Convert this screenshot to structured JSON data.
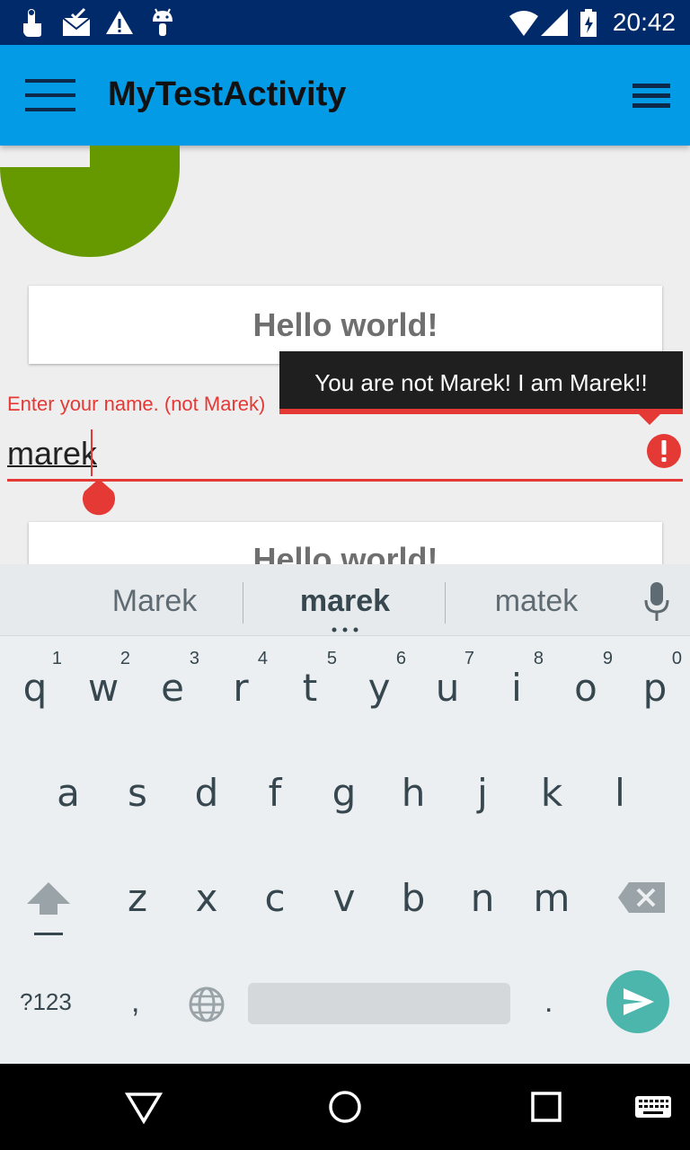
{
  "status_bar": {
    "time": "20:42",
    "icons": [
      "touch-icon",
      "mail-check-icon",
      "warning-triangle-icon",
      "android-debug-icon",
      "wifi-icon",
      "signal-icon",
      "battery-icon"
    ]
  },
  "app_bar": {
    "title": "MyTestActivity",
    "color": "#039be5"
  },
  "content": {
    "hello_card_1": "Hello world!",
    "hello_card_2": "Hello world!",
    "name_label": "Enter your name. (not Marek)",
    "name_value": "marek",
    "error_message": "You are not Marek! I am Marek!!",
    "error_color": "#e53935",
    "shape_color": "#669900"
  },
  "keyboard": {
    "suggestions": [
      "Marek",
      "marek",
      "matek"
    ],
    "row1": [
      {
        "letter": "q",
        "hint": "1"
      },
      {
        "letter": "w",
        "hint": "2"
      },
      {
        "letter": "e",
        "hint": "3"
      },
      {
        "letter": "r",
        "hint": "4"
      },
      {
        "letter": "t",
        "hint": "5"
      },
      {
        "letter": "y",
        "hint": "6"
      },
      {
        "letter": "u",
        "hint": "7"
      },
      {
        "letter": "i",
        "hint": "8"
      },
      {
        "letter": "o",
        "hint": "9"
      },
      {
        "letter": "p",
        "hint": "0"
      }
    ],
    "row2": [
      "a",
      "s",
      "d",
      "f",
      "g",
      "h",
      "j",
      "k",
      "l"
    ],
    "row3": [
      "z",
      "x",
      "c",
      "v",
      "b",
      "n",
      "m"
    ],
    "symbols_label": "?123",
    "comma": ",",
    "period": ".",
    "accent": "#4db6ac"
  },
  "nav_bar": {
    "buttons": [
      "back-icon",
      "home-icon",
      "recents-icon",
      "keyboard-switch-icon"
    ]
  }
}
